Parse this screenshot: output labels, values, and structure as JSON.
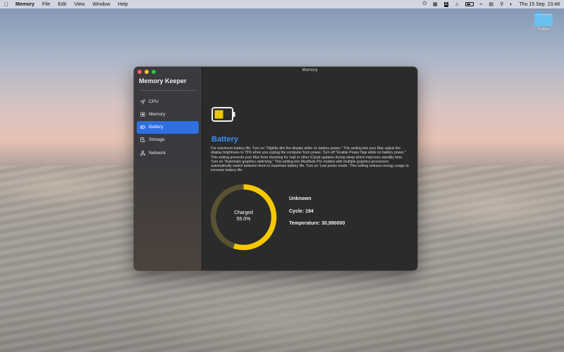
{
  "menubar": {
    "app_name": "Memory",
    "menus": [
      "File",
      "Edit",
      "View",
      "Window",
      "Help"
    ],
    "datetime": "Thu 15 Sep  23:48",
    "status_icons": [
      "power-icon",
      "keyboard-input-icon",
      "letter-a-icon",
      "sound-icon",
      "battery-icon",
      "wifi-icon",
      "control-center-icon",
      "search-icon",
      "control-center-toggle-icon"
    ]
  },
  "desktop": {
    "folder_label": "Folder"
  },
  "window": {
    "title": "Memory",
    "sidebar": {
      "app_title": "Memory Keeper",
      "items": [
        {
          "label": "CPU",
          "icon": "location-arrow-icon",
          "active": false
        },
        {
          "label": "Memory",
          "icon": "memory-chip-icon",
          "active": false
        },
        {
          "label": "Battery",
          "icon": "battery-icon",
          "active": true
        },
        {
          "label": "Storage",
          "icon": "storage-icon",
          "active": false
        },
        {
          "label": "Network",
          "icon": "network-icon",
          "active": false
        }
      ]
    },
    "content": {
      "title": "Battery",
      "description": "For maximum battery life: Turn on \"Slightly dim the display while on battery power.\" This setting lets your Mac adjust the display brightness to 75% when you unplug the computer from power. Turn off \"Enable Power Nap while on battery power.\" This setting prevents your Mac from checking for mail or other iCloud updates during sleep which improves standby time. Turn on \"Automatic graphics switching.\" This setting lets MacBook Pro models with multiple graphics processors automatically switch between them to maximize battery life. Turn on 'Low power mode.' This setting reduces energy usage to increase battery life.",
      "charge": {
        "label": "Charged",
        "value_text": "55.0%",
        "fraction": 0.55,
        "color": "#f5c800",
        "track_color": "#5a5230"
      },
      "stats": {
        "status": "Unknown",
        "cycle": "Cycle: 194",
        "temperature": "Temperature: 30,990000"
      }
    }
  }
}
